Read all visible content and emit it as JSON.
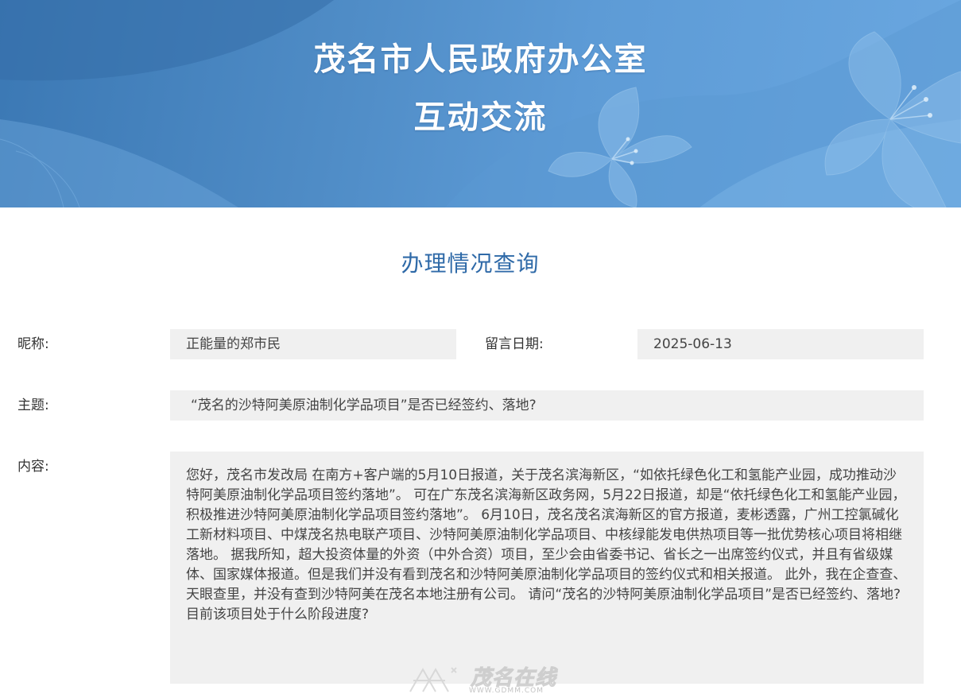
{
  "banner": {
    "title": "茂名市人民政府办公室",
    "subtitle": "互动交流",
    "colors": {
      "base": "#4f8cc6",
      "light": "#6aa7e0",
      "text": "#ffffff"
    }
  },
  "page": {
    "section_title": "办理情况查询"
  },
  "form": {
    "nickname_label": "昵称:",
    "nickname_value": "正能量的郑市民",
    "date_label": "留言日期:",
    "date_value": "2025-06-13",
    "subject_label": "主题:",
    "subject_value": "“茂名的沙特阿美原油制化学品项目”是否已经签约、落地?",
    "content_label": "内容:",
    "content_value": "您好，茂名市发改局 在南方+客户端的5月10日报道，关于茂名滨海新区，“如依托绿色化工和氢能产业园，成功推动沙特阿美原油制化学品项目签约落地”。 可在广东茂名滨海新区政务网，5月22日报道，却是“依托绿色化工和氢能产业园，积极推进沙特阿美原油制化学品项目签约落地”。 6月10日，茂名茂名滨海新区的官方报道，麦彬透露，广州工控氯碱化工新材料项目、中煤茂名热电联产项目、沙特阿美原油制化学品项目、中核绿能发电供热项目等一批优势核心项目将相继落地。 据我所知，超大投资体量的外资（中外合资）项目，至少会由省委书记、省长之一出席签约仪式，并且有省级媒体、国家媒体报道。但是我们并没有看到茂名和沙特阿美原油制化学品项目的签约仪式和相关报道。 此外，我在企查查、天眼查里，并没有查到沙特阿美在茂名本地注册有公司。 请问“茂名的沙特阿美原油制化学品项目”是否已经签约、落地?目前该项目处于什么阶段进度?"
  },
  "watermark": {
    "text": "茂名在线",
    "url": "WWW.GDMM.COM"
  }
}
